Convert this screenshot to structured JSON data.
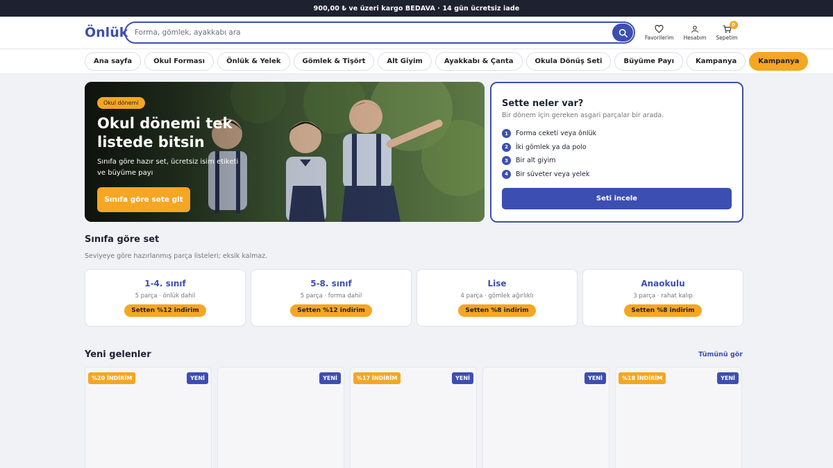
{
  "topbar": {
    "text": "900,00 ₺ ve üzeri kargo BEDAVA · 14 gün ücretsiz iade"
  },
  "header": {
    "logo": "Önlük",
    "search_placeholder": "Forma, gömlek, ayakkabı ara",
    "actions": [
      {
        "label": "Favorilerim",
        "icon": "heart-icon"
      },
      {
        "label": "Hesabım",
        "icon": "user-icon"
      },
      {
        "label": "Sepetim",
        "icon": "cart-icon",
        "count": "0"
      }
    ]
  },
  "nav": {
    "items": [
      "Ana sayfa",
      "Okul Forması",
      "Önlük & Yelek",
      "Gömlek & Tişört",
      "Alt Giyim",
      "Ayakkabı & Çanta",
      "Okula Dönüş Seti",
      "Büyüme Payı",
      "Kampanya",
      "Kampanya"
    ]
  },
  "hero": {
    "tag": "Okul dönemi",
    "title": "Okul dönemi tek listede bitsin",
    "subtitle": "Sınıfa göre hazır set, ücretsiz isim etiketi ve büyüme payı",
    "button": "Sınıfa göre sete git"
  },
  "setbox": {
    "title": "Sette neler var?",
    "subtitle": "Bir dönem için gereken asgari parçalar bir arada.",
    "items": [
      {
        "num": "1",
        "label": "Forma ceketi veya önlük"
      },
      {
        "num": "2",
        "label": "İki gömlek ya da polo"
      },
      {
        "num": "3",
        "label": "Bir alt giyim"
      },
      {
        "num": "4",
        "label": "Bir süveter veya yelek"
      }
    ],
    "button": "Seti incele"
  },
  "grades_section": {
    "title": "Sınıfa göre set",
    "subtitle": "Seviyeye göre hazırlanmış parça listeleri; eksik kalmaz.",
    "cards": [
      {
        "name": "1-4. sınıf",
        "info": "5 parça · önlük dahil",
        "discount": "Setten %12 indirim"
      },
      {
        "name": "5-8. sınıf",
        "info": "5 parça · forma dahil",
        "discount": "Setten %12 indirim"
      },
      {
        "name": "Lise",
        "info": "4 parça · gömlek ağırlıklı",
        "discount": "Setten %8 indirim"
      },
      {
        "name": "Anaokulu",
        "info": "3 parça · rahat kalıp",
        "discount": "Setten %8 indirim"
      }
    ]
  },
  "new_section": {
    "title": "Yeni gelenler",
    "see_all": "Tümünü gör",
    "products": [
      {
        "discount": "%20 İNDİRİM",
        "badge": "YENİ"
      },
      {
        "discount": "",
        "badge": "YENİ"
      },
      {
        "discount": "%17 İNDİRİM",
        "badge": "YENİ"
      },
      {
        "discount": "",
        "badge": "YENİ"
      },
      {
        "discount": "%18 İNDİRİM",
        "badge": "YENİ"
      }
    ]
  },
  "colors": {
    "brand": "#3d4eb2",
    "accent": "#f5a623",
    "topbar": "#1e2230"
  }
}
